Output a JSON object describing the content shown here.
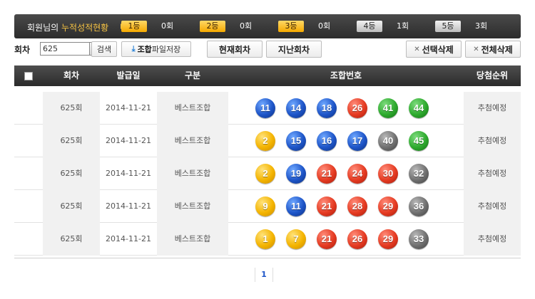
{
  "summary": {
    "title_prefix": "회원님의 ",
    "title_highlight": "누적성적현황",
    "ranks": [
      {
        "label": "1등",
        "count": "0회",
        "style": "gold"
      },
      {
        "label": "2등",
        "count": "0회",
        "style": "gold"
      },
      {
        "label": "3등",
        "count": "0회",
        "style": "gold"
      },
      {
        "label": "4등",
        "count": "1회",
        "style": "gray"
      },
      {
        "label": "5등",
        "count": "3회",
        "style": "gray"
      }
    ]
  },
  "controls": {
    "round_label": "회차",
    "round_value": "625",
    "search_label": "검색",
    "save_strong": "조합",
    "save_rest": " 파일저장",
    "current_label": "현재회차",
    "previous_label": "지난회차",
    "delete_selected_label": "선택삭제",
    "delete_all_label": "전체삭제"
  },
  "table": {
    "headers": {
      "round": "회차",
      "date": "발급일",
      "type": "구분",
      "numbers": "조합번호",
      "rank": "당첨순위"
    },
    "rows": [
      {
        "round": "625회",
        "date": "2014-11-21",
        "type": "베스트조합",
        "rank": "추첨예정",
        "numbers": [
          {
            "n": "11",
            "c": "blue"
          },
          {
            "n": "14",
            "c": "blue"
          },
          {
            "n": "18",
            "c": "blue"
          },
          {
            "n": "26",
            "c": "red"
          },
          {
            "n": "41",
            "c": "green"
          },
          {
            "n": "44",
            "c": "green"
          }
        ]
      },
      {
        "round": "625회",
        "date": "2014-11-21",
        "type": "베스트조합",
        "rank": "추첨예정",
        "numbers": [
          {
            "n": "2",
            "c": "yellow"
          },
          {
            "n": "15",
            "c": "blue"
          },
          {
            "n": "16",
            "c": "blue"
          },
          {
            "n": "17",
            "c": "blue"
          },
          {
            "n": "40",
            "c": "gray"
          },
          {
            "n": "45",
            "c": "green"
          }
        ]
      },
      {
        "round": "625회",
        "date": "2014-11-21",
        "type": "베스트조합",
        "rank": "추첨예정",
        "numbers": [
          {
            "n": "2",
            "c": "yellow"
          },
          {
            "n": "19",
            "c": "blue"
          },
          {
            "n": "21",
            "c": "red"
          },
          {
            "n": "24",
            "c": "red"
          },
          {
            "n": "30",
            "c": "red"
          },
          {
            "n": "32",
            "c": "gray"
          }
        ]
      },
      {
        "round": "625회",
        "date": "2014-11-21",
        "type": "베스트조합",
        "rank": "추첨예정",
        "numbers": [
          {
            "n": "9",
            "c": "yellow"
          },
          {
            "n": "11",
            "c": "blue"
          },
          {
            "n": "21",
            "c": "red"
          },
          {
            "n": "28",
            "c": "red"
          },
          {
            "n": "29",
            "c": "red"
          },
          {
            "n": "36",
            "c": "gray"
          }
        ]
      },
      {
        "round": "625회",
        "date": "2014-11-21",
        "type": "베스트조합",
        "rank": "추첨예정",
        "numbers": [
          {
            "n": "1",
            "c": "yellow"
          },
          {
            "n": "7",
            "c": "yellow"
          },
          {
            "n": "21",
            "c": "red"
          },
          {
            "n": "26",
            "c": "red"
          },
          {
            "n": "29",
            "c": "red"
          },
          {
            "n": "33",
            "c": "gray"
          }
        ]
      }
    ]
  },
  "pagination": {
    "current": "1"
  },
  "colors": {
    "yellow": "#f4b400",
    "blue": "#1e55c8",
    "red": "#e53b22",
    "gray": "#707070",
    "green": "#2eaa2e"
  }
}
